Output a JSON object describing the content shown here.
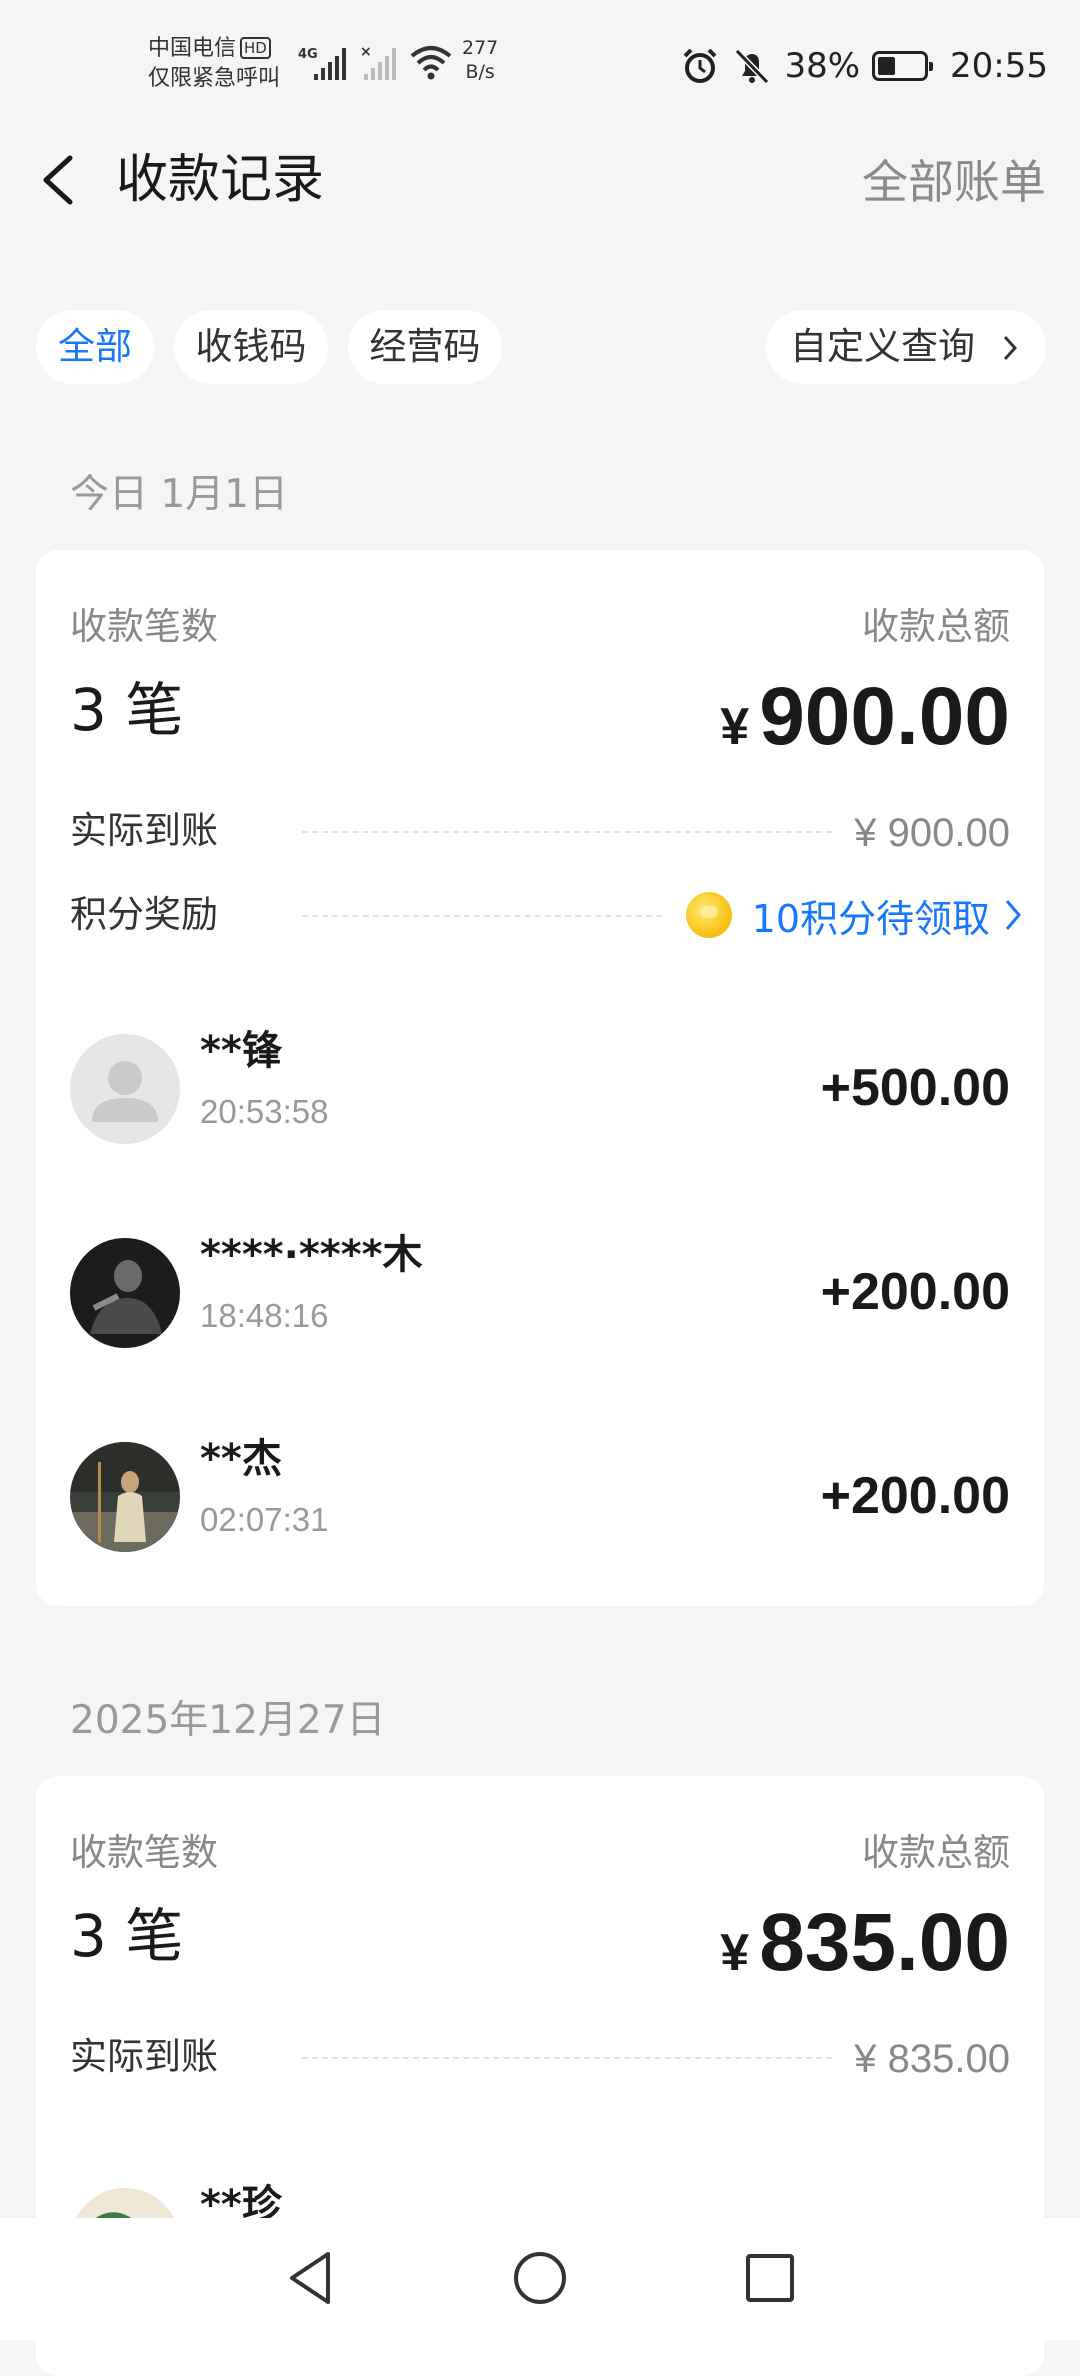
{
  "status_bar": {
    "carrier_line1": "中国电信",
    "hd_badge": "HD",
    "carrier_line2": "仅限紧急呼叫",
    "network_type": "4G",
    "speed_value": "277",
    "speed_unit": "B/s",
    "battery_percent": "38%",
    "battery_level": 0.38,
    "time": "20:55"
  },
  "header": {
    "title": "收款记录",
    "right_link": "全部账单"
  },
  "filters": {
    "chips": [
      "全部",
      "收钱码",
      "经营码"
    ],
    "active_index": 0,
    "custom_query": "自定义查询"
  },
  "sections": [
    {
      "date": "今日 1月1日",
      "count_label": "收款笔数",
      "count": "3 笔",
      "total_label": "收款总额",
      "total_currency": "¥",
      "total_amount": "900.00",
      "received_label": "实际到账",
      "received_value": "¥ 900.00",
      "reward_label": "积分奖励",
      "reward_value": "10积分待领取",
      "transactions": [
        {
          "name": "**锋",
          "time": "20:53:58",
          "amount": "+500.00",
          "avatar": "default-avatar"
        },
        {
          "name": "****·****木",
          "time": "18:48:16",
          "amount": "+200.00",
          "avatar": "photo-avatar"
        },
        {
          "name": "**杰",
          "time": "02:07:31",
          "amount": "+200.00",
          "avatar": "photo-avatar"
        }
      ]
    },
    {
      "date": "2025年12月27日",
      "count_label": "收款笔数",
      "count": "3 笔",
      "total_label": "收款总额",
      "total_currency": "¥",
      "total_amount": "835.00",
      "received_label": "实际到账",
      "received_value": "¥ 835.00",
      "transactions": [
        {
          "name": "**珍",
          "time": "",
          "amount": "",
          "avatar": "photo-avatar"
        }
      ]
    }
  ],
  "colors": {
    "accent_blue": "#1677ff",
    "background": "#f5f5f5",
    "card": "#ffffff"
  }
}
